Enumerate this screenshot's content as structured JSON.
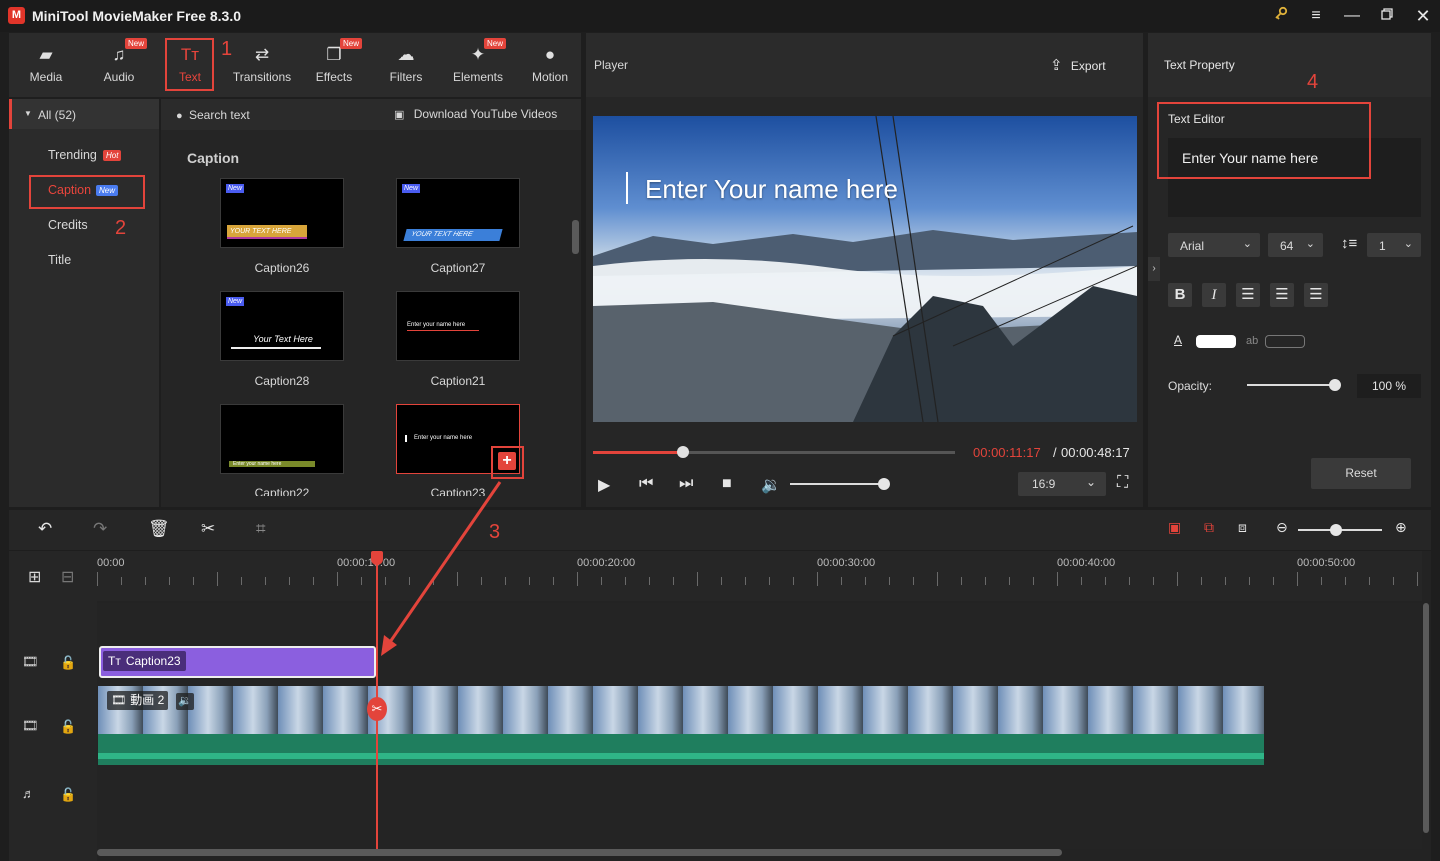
{
  "app": {
    "title": "MiniTool MovieMaker Free 8.3.0",
    "logo_letter": "M"
  },
  "toolbar": {
    "tabs": [
      {
        "label": "Media",
        "icon": "folder-icon",
        "new": false
      },
      {
        "label": "Audio",
        "icon": "music-note-icon",
        "new": true
      },
      {
        "label": "Text",
        "icon": "text-icon",
        "new": false,
        "active": true
      },
      {
        "label": "Transitions",
        "icon": "transitions-icon",
        "new": false
      },
      {
        "label": "Effects",
        "icon": "effects-icon",
        "new": true
      },
      {
        "label": "Filters",
        "icon": "filters-icon",
        "new": false
      },
      {
        "label": "Elements",
        "icon": "elements-icon",
        "new": true
      },
      {
        "label": "Motion",
        "icon": "motion-icon",
        "new": false
      }
    ],
    "new_badge": "New"
  },
  "annotations": {
    "n1": "1",
    "n2": "2",
    "n3": "3",
    "n4": "4"
  },
  "categories": {
    "all_label": "All (52)",
    "items": [
      "Trending",
      "Caption",
      "Credits",
      "Title"
    ],
    "hot_badge": "Hot",
    "new_badge": "New"
  },
  "content": {
    "search_placeholder": "Search text",
    "youtube_label": "Download YouTube Videos",
    "heading": "Caption",
    "thumbs": [
      {
        "label": "Caption26",
        "text": "YOUR TEXT HERE",
        "new": true
      },
      {
        "label": "Caption27",
        "text": "YOUR TEXT HERE",
        "new": true
      },
      {
        "label": "Caption28",
        "text": "Your Text Here",
        "new": true
      },
      {
        "label": "Caption21",
        "text": "Enter your name here",
        "new": false
      },
      {
        "label": "Caption22",
        "text": "Enter your name here",
        "new": false
      },
      {
        "label": "Caption23",
        "text": "Enter your name here",
        "new": false
      }
    ],
    "thumb_new": "New"
  },
  "player": {
    "title": "Player",
    "export_label": "Export",
    "overlay_text": "Enter Your name here",
    "time_current": "00:00:11:17",
    "time_separator": "/",
    "time_total": "00:00:48:17",
    "progress": 0.248,
    "aspect_ratio": "16:9"
  },
  "text_property": {
    "title": "Text Property",
    "editor_label": "Text Editor",
    "editor_text": "Enter Your name here",
    "font": "Arial",
    "size": "64",
    "line_spacing": "1",
    "opacity_label": "Opacity:",
    "opacity_value": "100 %",
    "opacity": 1.0,
    "reset_label": "Reset",
    "fmt_buttons": [
      "B",
      "I"
    ],
    "text_color": "#ffffff",
    "bg_label": "ab"
  },
  "timeline": {
    "ruler_labels": [
      "00:00",
      "00:00:10:00",
      "00:00:20:00",
      "00:00:30:00",
      "00:00:40:00",
      "00:00:50:00"
    ],
    "caption_clip_label": "Caption23",
    "video_clip_label": "動画 2"
  },
  "colors": {
    "accent": "#e3443b",
    "caption_clip": "#8b5fdf",
    "audio_wave": "#1f7e5e"
  }
}
